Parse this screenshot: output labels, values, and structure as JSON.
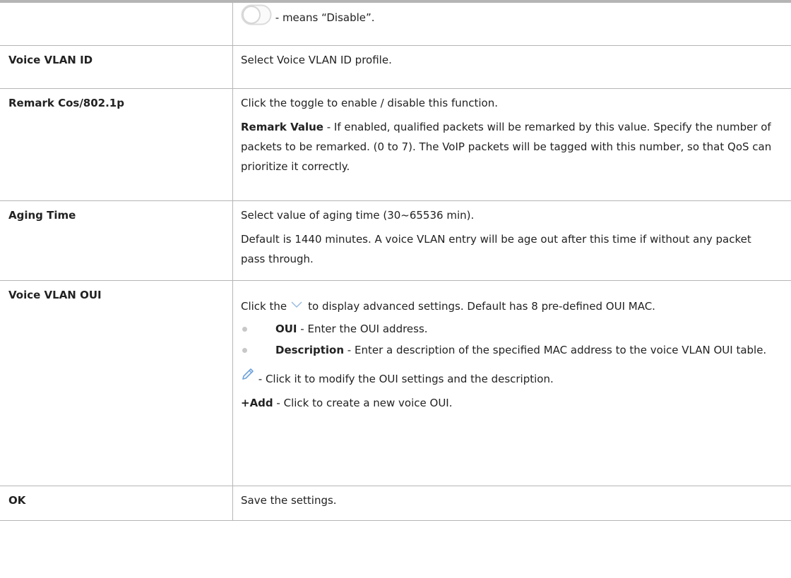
{
  "rows": [
    {
      "term": "",
      "desc_suffix": " - means “Disable”."
    },
    {
      "term": "Voice VLAN ID",
      "desc": "Select Voice VLAN ID profile."
    },
    {
      "term": "Remark Cos/802.1p",
      "desc_1": "Click the toggle to enable / disable this function.",
      "desc_2_bold": "Remark Value",
      "desc_2_rest": " - If enabled, qualified packets will be remarked by this value. Specify the number of packets to be remarked. (0 to 7). The VoIP packets will be tagged with this number, so that QoS can prioritize it correctly."
    },
    {
      "term": "Aging Time",
      "desc_1": "Select value of aging time (30~65536 min).",
      "desc_2": "Default is 1440 minutes. A voice VLAN entry will be age out after this time if without any packet pass through."
    },
    {
      "term": "Voice VLAN OUI",
      "lead_before": "Click the",
      "lead_after": "to display advanced settings. Default has 8 pre-defined OUI MAC.",
      "bullets": [
        {
          "bold": "OUI",
          "rest": " - Enter the OUI address."
        },
        {
          "bold": "Description",
          "rest": " - Enter a description of the specified MAC address to the voice VLAN OUI table."
        }
      ],
      "pencil_text": " - Click it to modify the OUI settings and the description.",
      "add_bold": "+Add",
      "add_rest": " - Click to create a new voice OUI."
    },
    {
      "term": "OK",
      "desc": "Save the settings."
    }
  ],
  "icons": {
    "toggle": "toggle-off-icon",
    "chevron": "chevron-down-icon",
    "pencil": "pencil-icon"
  },
  "colors": {
    "border": "#b5b5b5",
    "icon_blue": "#6fa3dc",
    "icon_gray": "#9bbbe0"
  }
}
